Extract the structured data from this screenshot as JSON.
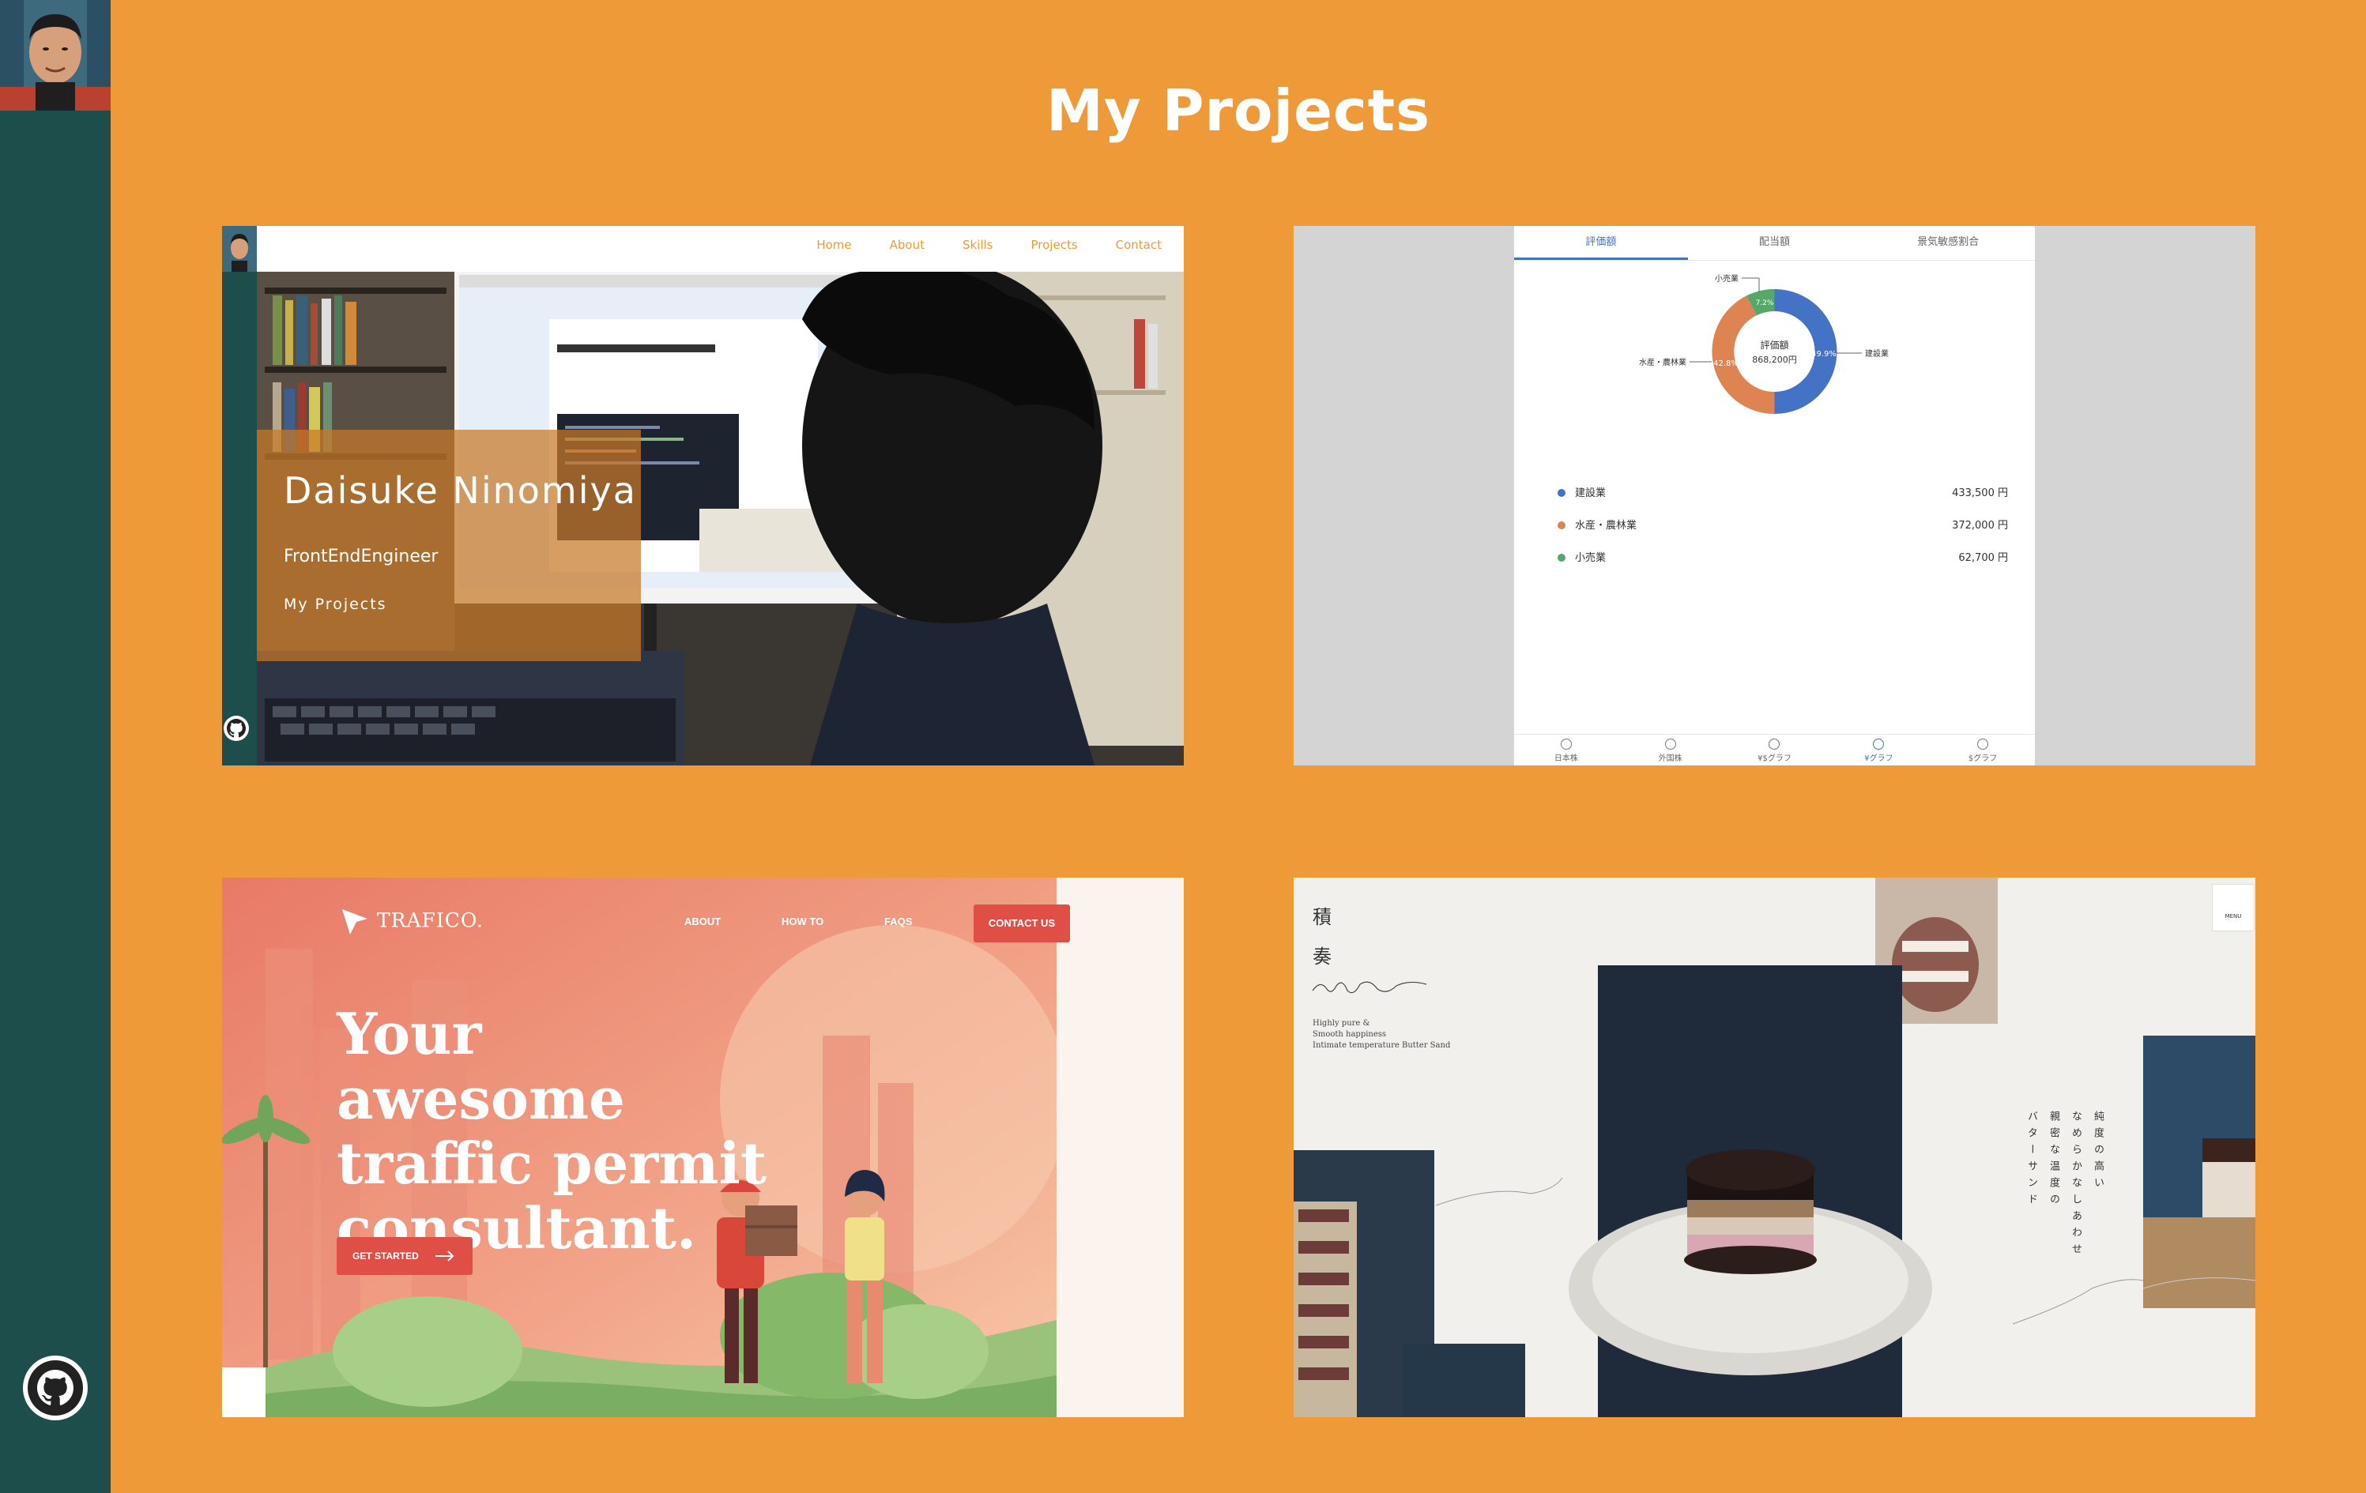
{
  "page": {
    "title": "My Projects"
  },
  "sidebar": {
    "avatar_icon": "avatar",
    "github_icon": "github-icon"
  },
  "projects": {
    "portfolio": {
      "nav": [
        "Home",
        "About",
        "Skills",
        "Projects",
        "Contact"
      ],
      "name": "Daisuke Ninomiya",
      "role": "FrontEndEngineer",
      "link": "My Projects"
    },
    "dashboard": {
      "tabs": [
        "評価額",
        "配当額",
        "景気敏感割合"
      ],
      "donut_center": {
        "title": "評価額",
        "value": "868,200円"
      },
      "donut_labels": {
        "pct_construction": "49.9%",
        "pct_fishery": "42.8%",
        "pct_retail": "7.2%",
        "label_construction": "建設業",
        "label_fishery": "水産・農林業",
        "label_retail": "小売業"
      },
      "legend": [
        {
          "label": "建設業",
          "value": "433,500 円",
          "color": "#4472C4"
        },
        {
          "label": "水産・農林業",
          "value": "372,000 円",
          "color": "#DD8452"
        },
        {
          "label": "小売業",
          "value": "62,700 円",
          "color": "#55A868"
        }
      ],
      "bottom_nav": [
        "日本株",
        "外国株",
        "¥$グラフ",
        "¥グラフ",
        "$グラフ"
      ]
    },
    "trafico": {
      "logo": "TRAFICO.",
      "nav": [
        "ABOUT",
        "HOW TO",
        "FAQS"
      ],
      "contact": "CONTACT US",
      "headline": "Your awesome traffic permit consultant.",
      "cta": "GET STARTED"
    },
    "sweets": {
      "title_1": "積",
      "title_2": "奏",
      "signature": "Sekiso",
      "tagline_1": "Highly pure &",
      "tagline_2": "Smooth happiness",
      "tagline_3": "Intimate temperature Butter Sand",
      "col_1": "純度の高い",
      "col_2": "なめらかなしあわせ",
      "col_3": "親密な温度の",
      "col_4": "バターサンド",
      "menu": "MENU"
    }
  }
}
